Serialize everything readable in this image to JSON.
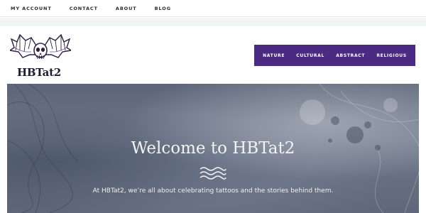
{
  "topbar": {
    "links": [
      {
        "label": "MY ACCOUNT"
      },
      {
        "label": "CONTACT"
      },
      {
        "label": "ABOUT"
      },
      {
        "label": "BLOG"
      }
    ]
  },
  "header": {
    "logo_text": "HBTat2",
    "nav": [
      {
        "label": "NATURE"
      },
      {
        "label": "CULTURAL"
      },
      {
        "label": "ABSTRACT"
      },
      {
        "label": "RELIGIOUS"
      }
    ]
  },
  "hero": {
    "title": "Welcome to HBTat2",
    "subtitle": "At HBTat2, we’re all about celebrating tattoos and the stories behind them."
  },
  "colors": {
    "nav_background": "#4b2b82",
    "hero_background": "#667084"
  }
}
